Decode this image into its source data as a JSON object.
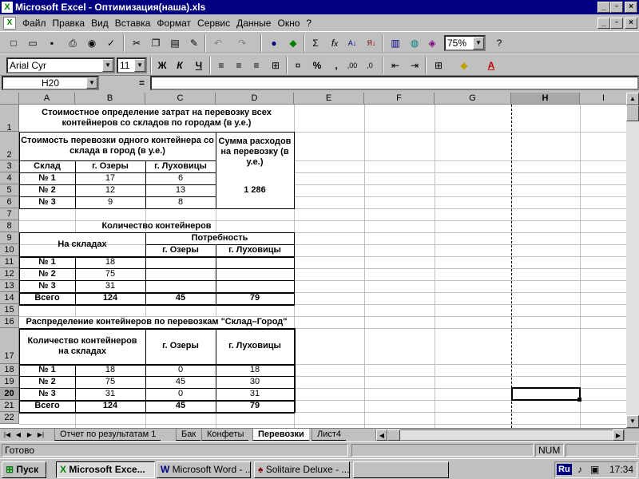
{
  "window": {
    "title": "Microsoft Excel - Оптимизация(наша).xls"
  },
  "menu": [
    "Файл",
    "Правка",
    "Вид",
    "Вставка",
    "Формат",
    "Сервис",
    "Данные",
    "Окно",
    "?"
  ],
  "format": {
    "font": "Arial Cyr",
    "size": "11",
    "bold": "Ж",
    "italic": "К",
    "underline": "Ч"
  },
  "standard": {
    "zoom": "75%"
  },
  "namebox": {
    "value": "H20",
    "eq": "="
  },
  "columns": [
    "A",
    "B",
    "C",
    "D",
    "E",
    "F",
    "G",
    "H",
    "I"
  ],
  "rows": [
    "1",
    "2",
    "3",
    "4",
    "5",
    "6",
    "7",
    "8",
    "9",
    "10",
    "11",
    "12",
    "13",
    "14",
    "15",
    "16",
    "17",
    "18",
    "19",
    "20",
    "21",
    "22"
  ],
  "sheet": {
    "t1_title": "Стоимостное определение затрат на перевозку всех контейнеров со складов по городам (в у.е.)",
    "t1_header_cost": "Стоимость перевозки одного контейнера со склада в город  (в у.е.)",
    "t1_header_sum": "Сумма расходов на перевозку (в у.е.)",
    "sklad": "Склад",
    "city1": "г. Озеры",
    "city2": "г. Луховицы",
    "t1_rows": [
      {
        "name": "№ 1",
        "c1": "17",
        "c2": "6"
      },
      {
        "name": "№ 2",
        "c1": "12",
        "c2": "13"
      },
      {
        "name": "№ 3",
        "c1": "9",
        "c2": "8"
      }
    ],
    "t1_total": "1 286",
    "t2_title": "Количество контейнеров",
    "t2_stock": "На складах",
    "t2_need": "Потребность",
    "t2_rows": [
      {
        "name": "№ 1",
        "v": "18"
      },
      {
        "name": "№ 2",
        "v": "75"
      },
      {
        "name": "№ 3",
        "v": "31"
      }
    ],
    "total_label": "Всего",
    "t2_total": {
      "v": "124",
      "c1": "45",
      "c2": "79"
    },
    "t3_title": "Распределение контейнеров по перевозкам \"Склад–Город\"",
    "t3_header": "Количество контейнеров на складах",
    "t3_rows": [
      {
        "name": "№ 1",
        "v": "18",
        "c1": "0",
        "c2": "18"
      },
      {
        "name": "№ 2",
        "v": "75",
        "c1": "45",
        "c2": "30"
      },
      {
        "name": "№ 3",
        "v": "31",
        "c1": "0",
        "c2": "31"
      }
    ],
    "t3_total": {
      "v": "124",
      "c1": "45",
      "c2": "79"
    }
  },
  "tabs": [
    "Отчет по результатам 1",
    "Бак",
    "Конфеты",
    "Перевозки",
    "Лист4"
  ],
  "status": {
    "ready": "Готово",
    "num": "NUM"
  },
  "taskbar": {
    "start": "Пуск",
    "items": [
      "Microsoft Exce...",
      "Microsoft Word - ...",
      "Solitaire Deluxe - ..."
    ],
    "lang": "Ru",
    "time": "17:34"
  }
}
